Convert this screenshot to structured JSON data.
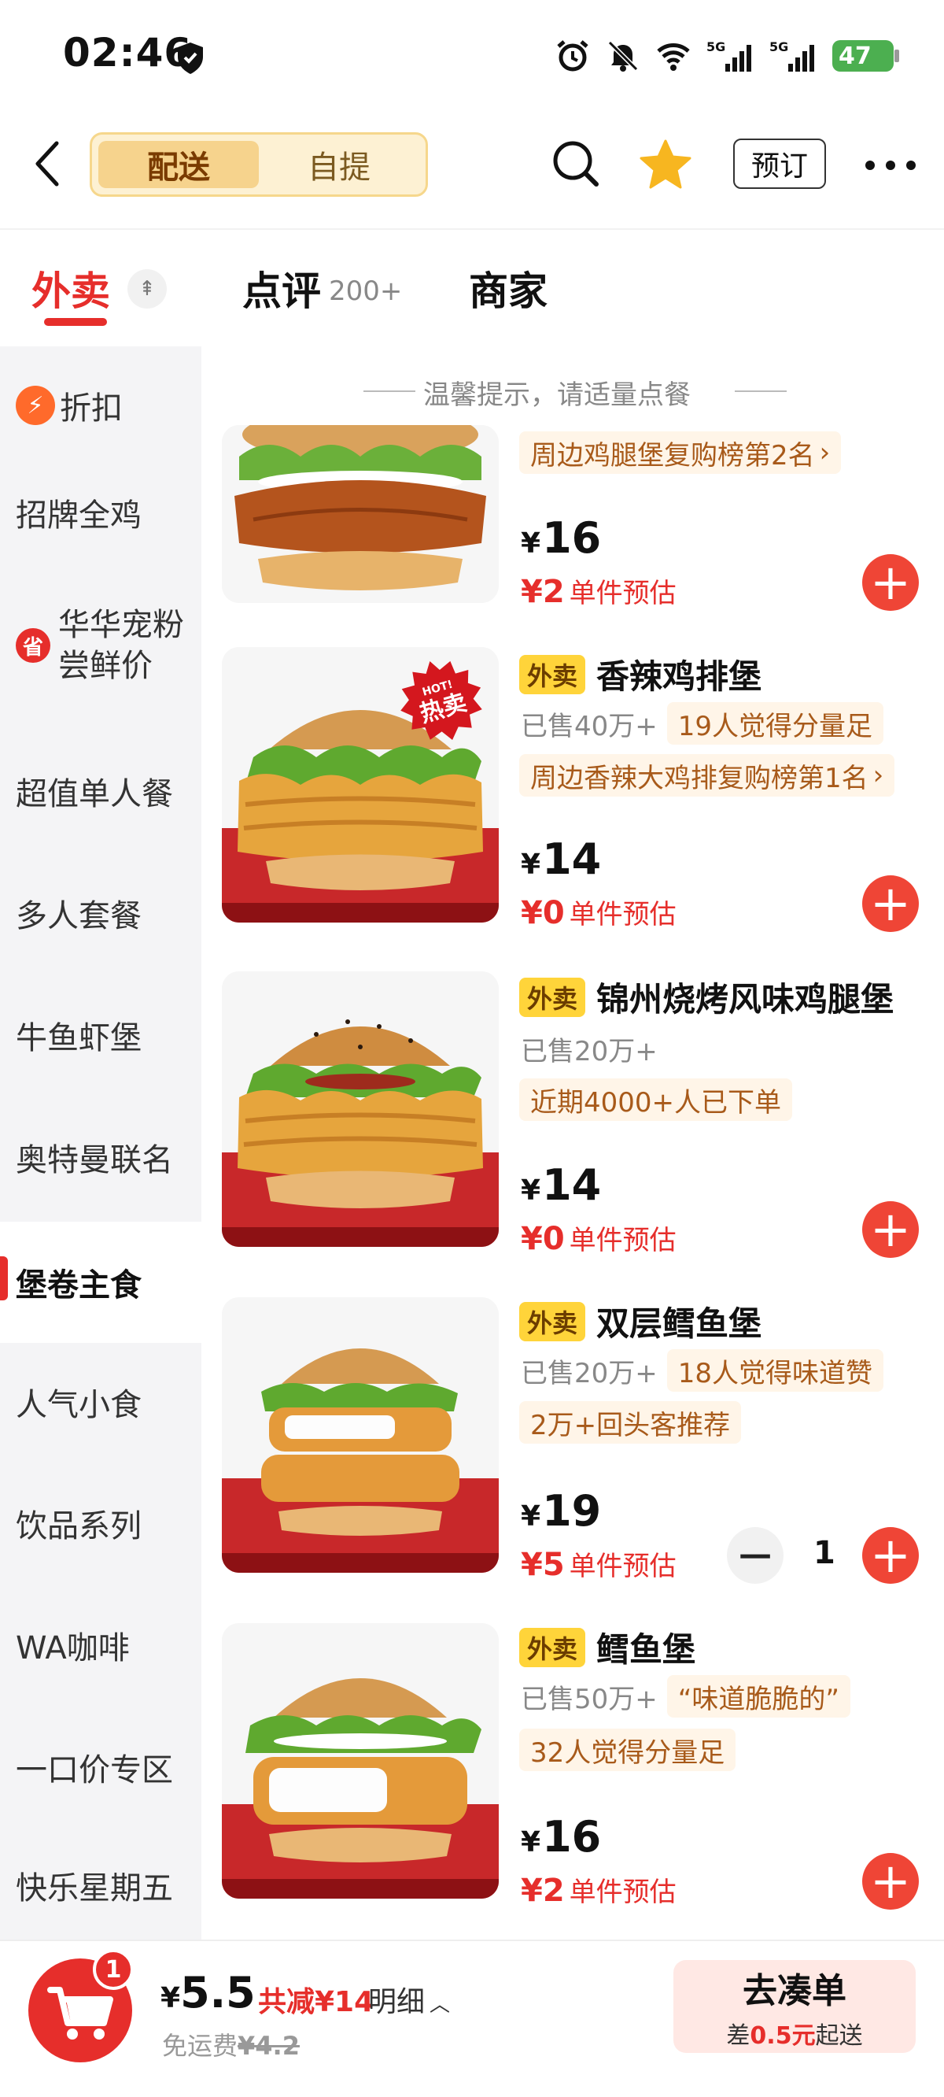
{
  "status_bar": {
    "time": "02:46",
    "battery": "47"
  },
  "nav": {
    "segments": [
      "配送",
      "自提"
    ],
    "preorder_label": "预订"
  },
  "tabs": {
    "waimai": "外卖",
    "dianping": "点评",
    "dianping_count": "200+",
    "shangjia": "商家"
  },
  "sidebar": {
    "items": [
      {
        "label": "折扣"
      },
      {
        "label": "招牌全鸡"
      },
      {
        "label": "华华宠粉\n尝鲜价",
        "badge": "省"
      },
      {
        "label": "超值单人餐"
      },
      {
        "label": "多人套餐"
      },
      {
        "label": "牛鱼虾堡"
      },
      {
        "label": "奥特曼联名"
      },
      {
        "label": "堡卷主食"
      },
      {
        "label": "人气小食"
      },
      {
        "label": "饮品系列"
      },
      {
        "label": "WA咖啡"
      },
      {
        "label": "一口价专区"
      },
      {
        "label": "快乐星期五"
      }
    ]
  },
  "notice": "温馨提示，请适量点餐",
  "products": [
    {
      "rank": "周边鸡腿堡复购榜第2名",
      "price": "16",
      "est": "¥2",
      "est_label": "单件预估"
    },
    {
      "tag": "外卖",
      "name": "香辣鸡排堡",
      "sold": "已售40万+",
      "pill1": "19人觉得分量足",
      "rank": "周边香辣大鸡排复购榜第1名",
      "price": "14",
      "est": "¥0",
      "est_label": "单件预估",
      "hot": "热卖",
      "hot_small": "HOT!"
    },
    {
      "tag": "外卖",
      "name": "锦州烧烤风味鸡腿堡",
      "sold": "已售20万+",
      "pill1": "近期4000+人已下单",
      "price": "14",
      "est": "¥0",
      "est_label": "单件预估"
    },
    {
      "tag": "外卖",
      "name": "双层鳕鱼堡",
      "sold": "已售20万+",
      "pill1": "18人觉得味道赞",
      "pill2": "2万+回头客推荐",
      "price": "19",
      "est": "¥5",
      "est_label": "单件预估",
      "qty": "1"
    },
    {
      "tag": "外卖",
      "name": "鳕鱼堡",
      "sold": "已售50万+",
      "pill1": "“味道脆脆的”",
      "pill2": "32人觉得分量足",
      "price": "16",
      "est": "¥2",
      "est_label": "单件预估"
    }
  ],
  "cart": {
    "badge": "1",
    "total": "5.5",
    "reduce": "共减¥14",
    "detail": "明细",
    "freeship": "免运费",
    "freeship_orig": "¥4.2",
    "checkout_label": "去凑单",
    "checkout_prefix": "差",
    "checkout_amount": "0.5元",
    "checkout_suffix": "起送"
  },
  "colors": {
    "accent": "#e62e2b",
    "tag_yellow": "#ffd43a",
    "seg_bg": "#fdf1d3"
  }
}
